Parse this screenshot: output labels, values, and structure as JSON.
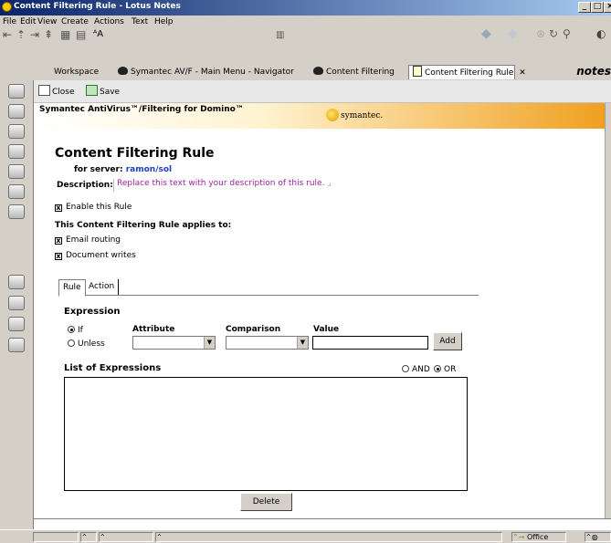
{
  "window": {
    "title": "Content Filtering Rule - Lotus Notes"
  },
  "menu": [
    "File",
    "Edit",
    "View",
    "Create",
    "Actions",
    "Text",
    "Help"
  ],
  "toolbar": {
    "font_size_label": "AA"
  },
  "tabs": [
    {
      "label": "Workspace"
    },
    {
      "label": "Symantec AV/F - Main Menu - Navigator"
    },
    {
      "label": "Content Filtering"
    },
    {
      "label": "Content Filtering Rule"
    }
  ],
  "notes_logo": "notes",
  "actions": {
    "close": "Close",
    "save": "Save"
  },
  "banner": {
    "product": "Symantec AntiVirus™/Filtering for Domino™",
    "brand": "symantec."
  },
  "form": {
    "title": "Content Filtering Rule",
    "server_label": "for server:",
    "server_value": "ramon/sol",
    "description_label": "Description:",
    "description_value": "Replace this text with your description of this rule.",
    "enable_label": "Enable this Rule",
    "applies_label": "This Content Filtering Rule applies to:",
    "email_routing": "Email routing",
    "document_writes": "Document writes",
    "subtabs": [
      "Rule",
      "Action"
    ],
    "expression_heading": "Expression",
    "if_label": "If",
    "unless_label": "Unless",
    "col_attribute": "Attribute",
    "col_comparison": "Comparison",
    "col_value": "Value",
    "add_button": "Add",
    "list_heading": "List of Expressions",
    "and_label": "AND",
    "or_label": "OR",
    "delete_button": "Delete"
  },
  "status": {
    "location": "Office"
  }
}
